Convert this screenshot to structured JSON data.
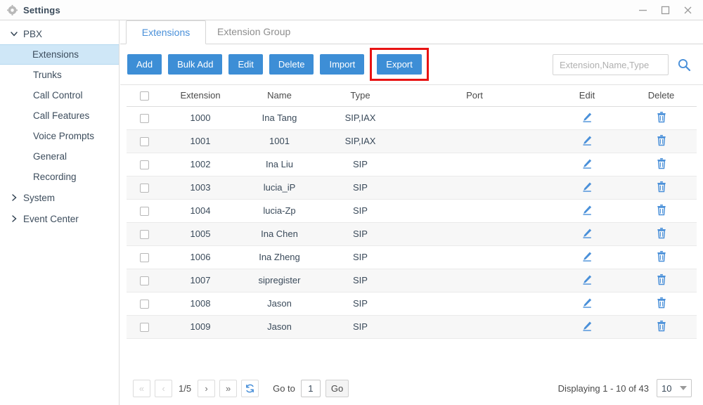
{
  "window": {
    "title": "Settings",
    "icon": "gear-icon",
    "controls": {
      "minimize": "minimize-icon",
      "maximize": "maximize-icon",
      "close": "close-icon"
    }
  },
  "sidebar": {
    "groups": [
      {
        "label": "PBX",
        "expanded": true,
        "caret": "chevron-down-icon",
        "items": [
          {
            "label": "Extensions",
            "active": true
          },
          {
            "label": "Trunks",
            "active": false
          },
          {
            "label": "Call Control",
            "active": false
          },
          {
            "label": "Call Features",
            "active": false
          },
          {
            "label": "Voice Prompts",
            "active": false
          },
          {
            "label": "General",
            "active": false
          },
          {
            "label": "Recording",
            "active": false
          }
        ]
      },
      {
        "label": "System",
        "expanded": false,
        "caret": "chevron-right-icon",
        "items": []
      },
      {
        "label": "Event Center",
        "expanded": false,
        "caret": "chevron-right-icon",
        "items": []
      }
    ]
  },
  "tabs": [
    {
      "label": "Extensions",
      "active": true
    },
    {
      "label": "Extension Group",
      "active": false
    }
  ],
  "toolbar": {
    "buttons": [
      {
        "label": "Add"
      },
      {
        "label": "Bulk Add"
      },
      {
        "label": "Edit"
      },
      {
        "label": "Delete"
      },
      {
        "label": "Import"
      }
    ],
    "export": {
      "label": "Export",
      "highlighted": true,
      "highlight_color": "#e81313"
    },
    "accent_color": "#3d8ed6"
  },
  "search": {
    "placeholder": "Extension,Name,Type",
    "value": "",
    "icon": "search-icon"
  },
  "table": {
    "columns": [
      "",
      "Extension",
      "Name",
      "Type",
      "Port",
      "Edit",
      "Delete"
    ],
    "rows": [
      {
        "extension": "1000",
        "name": "Ina Tang",
        "type": "SIP,IAX",
        "port": ""
      },
      {
        "extension": "1001",
        "name": "1001",
        "type": "SIP,IAX",
        "port": ""
      },
      {
        "extension": "1002",
        "name": "Ina Liu",
        "type": "SIP",
        "port": ""
      },
      {
        "extension": "1003",
        "name": "lucia_iP",
        "type": "SIP",
        "port": ""
      },
      {
        "extension": "1004",
        "name": "lucia-Zp",
        "type": "SIP",
        "port": ""
      },
      {
        "extension": "1005",
        "name": "Ina Chen",
        "type": "SIP",
        "port": ""
      },
      {
        "extension": "1006",
        "name": "Ina Zheng",
        "type": "SIP",
        "port": ""
      },
      {
        "extension": "1007",
        "name": "sipregister",
        "type": "SIP",
        "port": ""
      },
      {
        "extension": "1008",
        "name": "Jason",
        "type": "SIP",
        "port": ""
      },
      {
        "extension": "1009",
        "name": "Jason",
        "type": "SIP",
        "port": ""
      }
    ],
    "row_icons": {
      "edit": "pencil-icon",
      "delete": "trash-icon"
    },
    "icon_color": "#4a90d9"
  },
  "footer": {
    "first_label": "«",
    "prev_label": "‹",
    "page_indicator": "1/5",
    "next_label": "›",
    "last_label": "»",
    "refresh_icon": "refresh-icon",
    "goto_label": "Go to",
    "goto_value": "1",
    "go_label": "Go",
    "displaying": "Displaying 1 - 10 of 43",
    "page_size": "10"
  }
}
